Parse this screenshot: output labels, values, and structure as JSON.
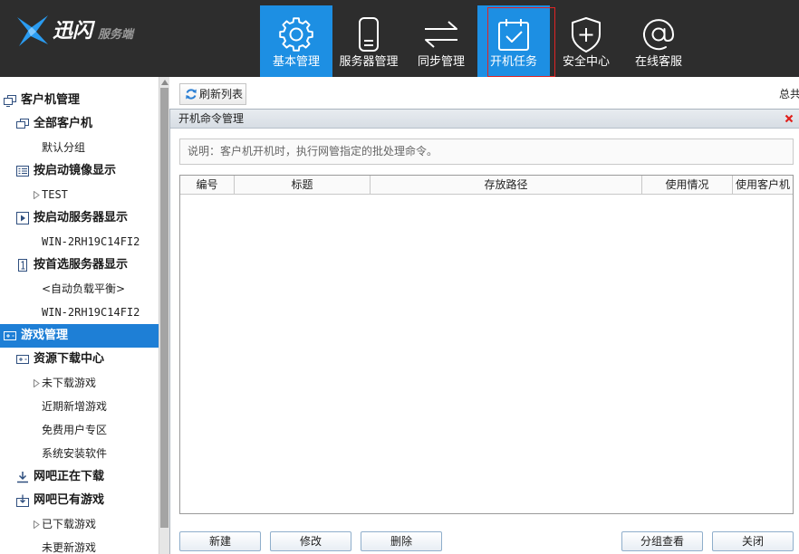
{
  "app": {
    "logo_main": "迅闪",
    "logo_sub": "服务端"
  },
  "colors": {
    "header_bg": "#2d2d2d",
    "nav_active_bg": "#1d8fe3",
    "highlight_border": "#e02424",
    "sidebar_selected_bg": "#1e7fd6",
    "close_icon": "#e0201c",
    "refresh_icon": "#2a7fd4"
  },
  "nav": [
    {
      "label": "基本管理",
      "icon": "gear-icon",
      "active": true
    },
    {
      "label": "服务器管理",
      "icon": "server-icon",
      "active": false
    },
    {
      "label": "同步管理",
      "icon": "sync-arrows-icon",
      "active": false
    },
    {
      "label": "开机任务",
      "icon": "calendar-check-icon",
      "active": true
    },
    {
      "label": "安全中心",
      "icon": "shield-plus-icon",
      "active": false
    },
    {
      "label": "在线客服",
      "icon": "at-sign-icon",
      "active": false
    }
  ],
  "sidebar": {
    "items": [
      {
        "label": "客户机管理",
        "icon": "monitors-icon"
      },
      {
        "label": "全部客户机",
        "icon": "windows-icon"
      },
      {
        "label": "默认分组"
      },
      {
        "label": "按启动镜像显示",
        "icon": "list-icon"
      },
      {
        "label": "TEST",
        "expandable": true
      },
      {
        "label": "按启动服务器显示",
        "icon": "play-box-icon"
      },
      {
        "label": "WIN-2RH19C14FI2"
      },
      {
        "label": "按首选服务器显示",
        "icon": "server-one-icon"
      },
      {
        "label": "<自动负载平衡>"
      },
      {
        "label": "WIN-2RH19C14FI2"
      },
      {
        "label": "游戏管理",
        "icon": "gamepad-icon",
        "selected": true
      },
      {
        "label": "资源下载中心",
        "icon": "gamepad-icon"
      },
      {
        "label": "未下载游戏",
        "expandable": true
      },
      {
        "label": "近期新增游戏"
      },
      {
        "label": "免费用户专区"
      },
      {
        "label": "系统安装软件"
      },
      {
        "label": "网吧正在下载",
        "icon": "download-icon"
      },
      {
        "label": "网吧已有游戏",
        "icon": "download-box-icon"
      },
      {
        "label": "已下载游戏",
        "expandable": true
      },
      {
        "label": "未更新游戏"
      }
    ]
  },
  "toolbar": {
    "refresh_label": "刷新列表",
    "total_label": "总共"
  },
  "dialog": {
    "title": "开机命令管理",
    "note": "说明：客户机开机时，执行网管指定的批处理命令。",
    "columns": [
      "编号",
      "标题",
      "存放路径",
      "使用情况",
      "使用客户机"
    ],
    "rows": [],
    "buttons": {
      "new": "新建",
      "edit": "修改",
      "delete": "删除",
      "group_view": "分组查看",
      "close": "关闭"
    }
  }
}
